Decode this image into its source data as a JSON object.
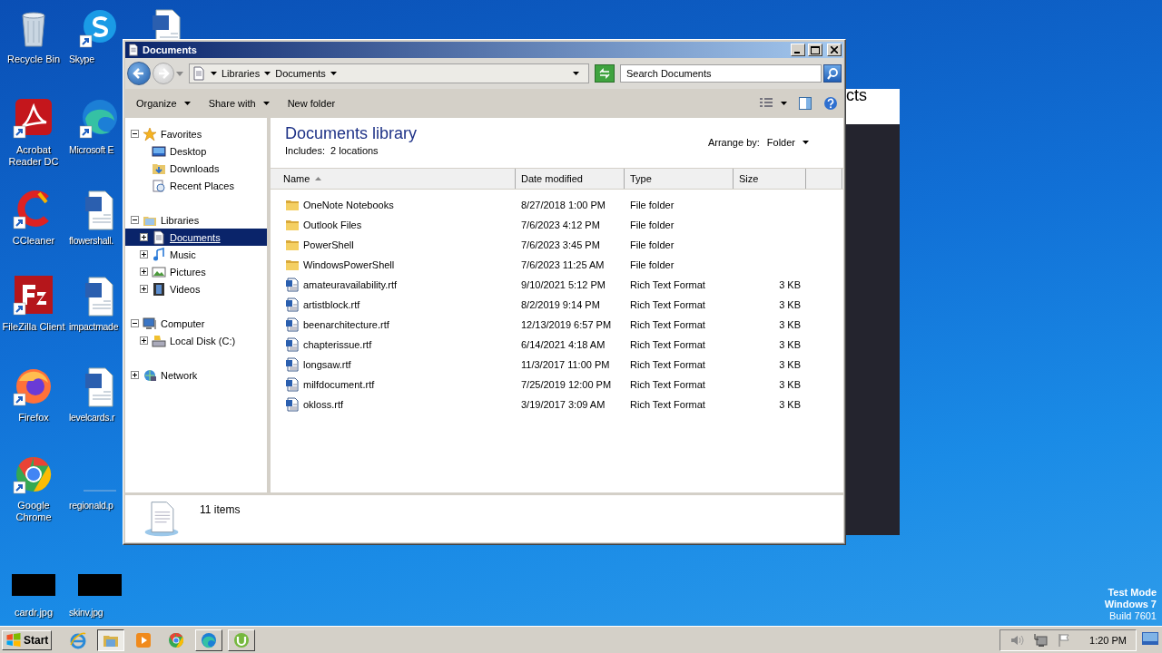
{
  "desktop": {
    "icons": [
      {
        "label": "Recycle Bin",
        "kind": "recycle",
        "shortcut": false
      },
      {
        "label": "Skype",
        "kind": "skype",
        "shortcut": true
      },
      {
        "kind": "word",
        "shortcut": false
      },
      {
        "label": "Acrobat Reader DC",
        "kind": "acrobat",
        "shortcut": true
      },
      {
        "label": "Microsoft E",
        "kind": "edge",
        "shortcut": true
      },
      {
        "label": "CCleaner",
        "kind": "ccleaner",
        "shortcut": true
      },
      {
        "label": "flowershall.",
        "kind": "word",
        "shortcut": false
      },
      {
        "label": "FileZilla Client",
        "kind": "filezilla",
        "shortcut": true
      },
      {
        "label": "impactmade",
        "kind": "word",
        "shortcut": false
      },
      {
        "label": "Firefox",
        "kind": "firefox",
        "shortcut": true
      },
      {
        "label": "levelcards.r",
        "kind": "word",
        "shortcut": false
      },
      {
        "label": "Google Chrome",
        "kind": "chrome",
        "shortcut": true
      },
      {
        "label": "regionald.p",
        "kind": "blank",
        "shortcut": false
      },
      {
        "label": "cardr.jpg",
        "kind": "image",
        "shortcut": false
      },
      {
        "label": "skinv.jpg",
        "kind": "image",
        "shortcut": false
      }
    ],
    "status_text": [
      "Test Mode",
      "Windows 7",
      "Build 7601"
    ]
  },
  "background_window": {
    "text": "cts"
  },
  "window": {
    "title": "Documents",
    "breadcrumb": [
      "Libraries",
      "Documents"
    ],
    "search": {
      "placeholder": "Search Documents"
    },
    "toolbar": [
      {
        "label": "Organize",
        "dropdown": true
      },
      {
        "label": "Share with",
        "dropdown": true
      },
      {
        "label": "New folder",
        "dropdown": false
      }
    ],
    "navigation": [
      {
        "label": "Favorites",
        "expanded": true,
        "selected": false,
        "children": [
          {
            "label": "Desktop",
            "selected": false
          },
          {
            "label": "Downloads",
            "selected": false
          },
          {
            "label": "Recent Places",
            "selected": false
          }
        ]
      },
      {
        "label": "Libraries",
        "expanded": true,
        "selected": false,
        "children": [
          {
            "label": "Documents",
            "selected": true,
            "expanded": false
          },
          {
            "label": "Music",
            "selected": false,
            "expanded": false
          },
          {
            "label": "Pictures",
            "selected": false,
            "expanded": false
          },
          {
            "label": "Videos",
            "selected": false,
            "expanded": false
          }
        ]
      },
      {
        "label": "Computer",
        "expanded": true,
        "selected": false,
        "children": [
          {
            "label": "Local Disk (C:)",
            "selected": false,
            "expanded": false
          }
        ]
      },
      {
        "label": "Network",
        "expanded": false,
        "selected": false
      }
    ],
    "library": {
      "title": "Documents library",
      "includes_label": "Includes:",
      "includes_link": "2 locations",
      "arrange_label": "Arrange by:",
      "arrange_value": "Folder"
    },
    "columns": [
      {
        "label": "Name",
        "sorted": true
      },
      {
        "label": "Date modified",
        "sorted": false
      },
      {
        "label": "Type",
        "sorted": false
      },
      {
        "label": "Size",
        "sorted": false
      }
    ],
    "rows": [
      {
        "name": "OneNote Notebooks",
        "date": "8/27/2018 1:00 PM",
        "type": "File folder",
        "kind": "folder"
      },
      {
        "name": "Outlook Files",
        "date": "7/6/2023 4:12 PM",
        "type": "File folder",
        "kind": "folder"
      },
      {
        "name": "PowerShell",
        "date": "7/6/2023 3:45 PM",
        "type": "File folder",
        "kind": "folder"
      },
      {
        "name": "WindowsPowerShell",
        "date": "7/6/2023 11:25 AM",
        "type": "File folder",
        "kind": "folder"
      },
      {
        "name": "amateuravailability.rtf",
        "date": "9/10/2021 5:12 PM",
        "type": "Rich Text Format",
        "size": "3 KB",
        "kind": "rtf"
      },
      {
        "name": "artistblock.rtf",
        "date": "8/2/2019 9:14 PM",
        "type": "Rich Text Format",
        "size": "3 KB",
        "kind": "rtf"
      },
      {
        "name": "beenarchitecture.rtf",
        "date": "12/13/2019 6:57 PM",
        "type": "Rich Text Format",
        "size": "3 KB",
        "kind": "rtf"
      },
      {
        "name": "chapterissue.rtf",
        "date": "6/14/2021 4:18 AM",
        "type": "Rich Text Format",
        "size": "3 KB",
        "kind": "rtf"
      },
      {
        "name": "longsaw.rtf",
        "date": "11/3/2017 11:00 PM",
        "type": "Rich Text Format",
        "size": "3 KB",
        "kind": "rtf"
      },
      {
        "name": "milfdocument.rtf",
        "date": "7/25/2019 12:00 PM",
        "type": "Rich Text Format",
        "size": "3 KB",
        "kind": "rtf"
      },
      {
        "name": "okloss.rtf",
        "date": "3/19/2017 3:09 AM",
        "type": "Rich Text Format",
        "size": "3 KB",
        "kind": "rtf"
      }
    ],
    "status": "11 items"
  },
  "taskbar": {
    "start": "Start",
    "apps": [
      {
        "kind": "ie",
        "running": false,
        "active": false
      },
      {
        "kind": "explorer",
        "running": true,
        "active": true
      },
      {
        "kind": "media",
        "running": false,
        "active": false
      },
      {
        "kind": "chrome",
        "running": false,
        "active": false
      },
      {
        "kind": "edge",
        "running": true,
        "active": false
      },
      {
        "kind": "utorrent",
        "running": true,
        "active": false
      }
    ],
    "clock": "1:20 PM"
  }
}
